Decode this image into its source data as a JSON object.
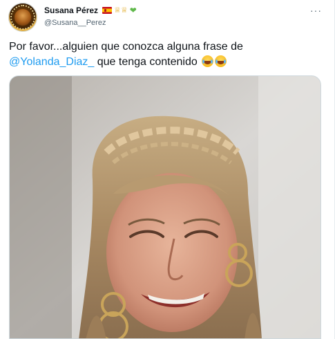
{
  "tweet": {
    "author": {
      "display_name": "Susana Pérez",
      "handle": "@Susana__Perez",
      "badges": [
        "spain-flag-emoji",
        "crown-emoji",
        "green-heart-emoji"
      ]
    },
    "more_glyph": "···",
    "text": {
      "prefix": "Por favor...alguien que conozca alguna frase de",
      "mention": "@Yolanda_Diaz_",
      "suffix": " que tenga contenido ",
      "trailing_emoji": [
        "face-with-tears-of-joy",
        "face-with-tears-of-joy"
      ]
    },
    "media": {
      "icon": "photo-of-smiling-woman-with-braided-hair-and-hoop-earrings"
    }
  },
  "colors": {
    "text": "#0f1419",
    "secondary": "#536471",
    "link": "#1d9bf0",
    "border": "#cfd9de"
  }
}
